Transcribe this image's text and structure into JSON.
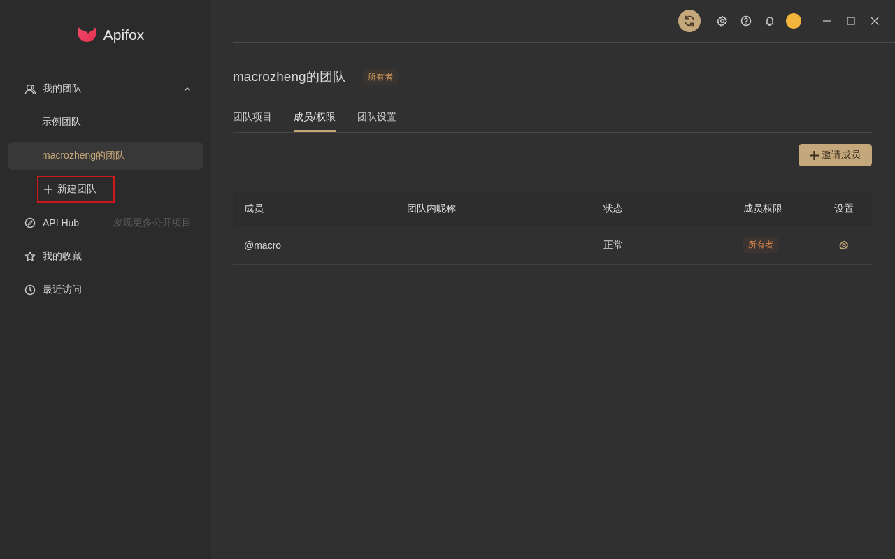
{
  "app": {
    "name": "Apifox"
  },
  "sidebar": {
    "items": [
      {
        "kind": "group",
        "label": "我的团队",
        "expanded": true,
        "children": [
          {
            "kind": "team",
            "label": "示例团队",
            "selected": false
          },
          {
            "kind": "team",
            "label": "macrozheng的团队",
            "selected": true
          },
          {
            "kind": "action",
            "label": "新建团队",
            "highlighted": true
          }
        ]
      },
      {
        "kind": "link",
        "label": "API Hub",
        "hint": "发现更多公开项目"
      },
      {
        "kind": "link",
        "label": "我的收藏"
      },
      {
        "kind": "link",
        "label": "最近访问"
      }
    ]
  },
  "team": {
    "title": "macrozheng的团队",
    "role": "所有者"
  },
  "tabs": [
    {
      "label": "团队项目",
      "selected": false
    },
    {
      "label": "成员/权限",
      "selected": true
    },
    {
      "label": "团队设置",
      "selected": false
    }
  ],
  "invite_button": {
    "label": "邀请成员"
  },
  "table": {
    "columns": [
      "成员",
      "团队内昵称",
      "状态",
      "成员权限",
      "设置"
    ],
    "rows": [
      {
        "member": "@macro",
        "status": "正常",
        "role": "所有者"
      }
    ]
  }
}
